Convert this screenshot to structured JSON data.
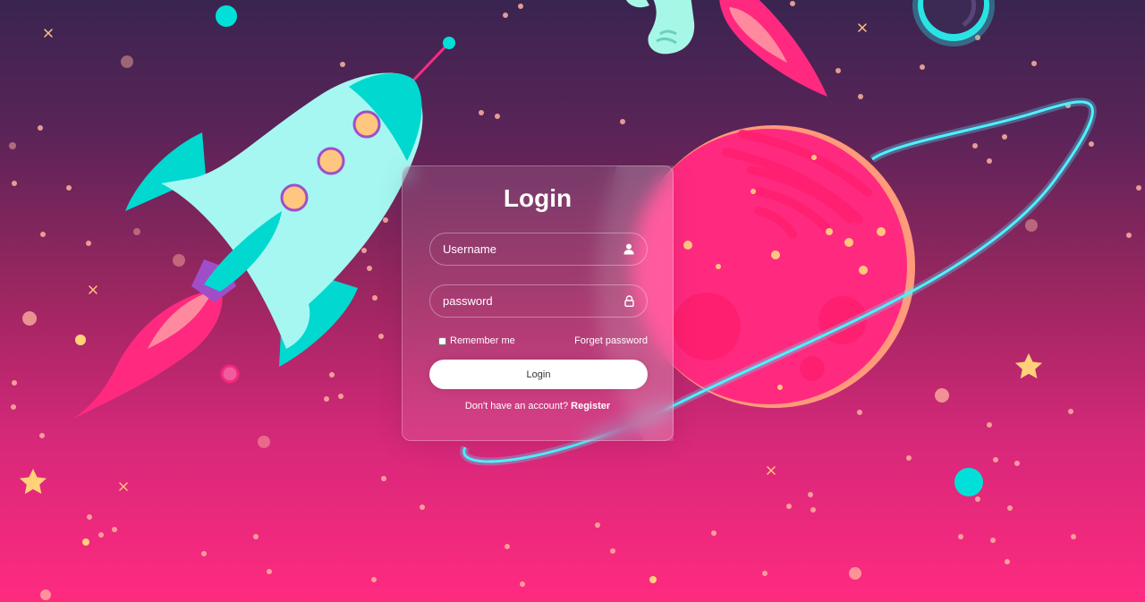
{
  "login": {
    "title": "Login",
    "username": {
      "placeholder": "Username",
      "value": "",
      "icon": "user-icon"
    },
    "password": {
      "placeholder": "password",
      "value": "",
      "icon": "lock-icon"
    },
    "remember_label": "Remember me",
    "forgot_label": "Forget password",
    "submit_label": "Login",
    "register_prompt": "Don't have an account?",
    "register_label": "Register"
  },
  "background": {
    "theme": "space",
    "colors": {
      "sky_top": "#3a2450",
      "sky_bottom": "#ff2a80",
      "planet": "#ff2a80",
      "ring": "#4df2ff",
      "rocket_body": "#a6f7f2",
      "rocket_fins": "#00d8d0",
      "window": "#ffc680",
      "flame": "#ff2a80",
      "star": "#ffd27a"
    }
  }
}
